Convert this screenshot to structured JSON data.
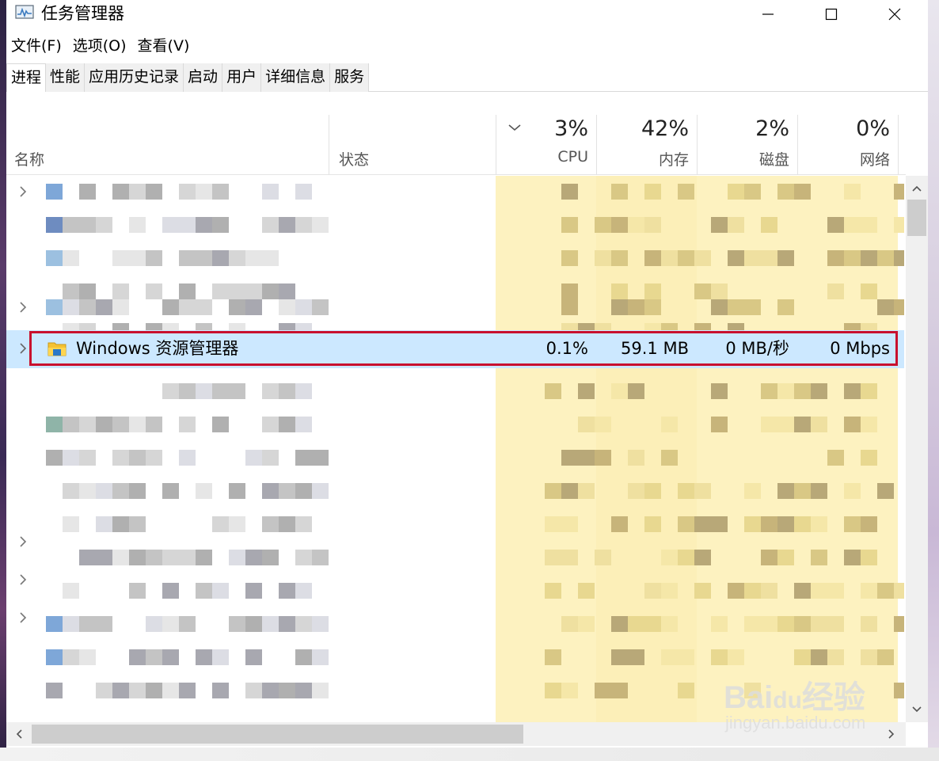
{
  "window": {
    "title": "任务管理器",
    "controls": [
      "minimize-button",
      "maximize-button",
      "close-button"
    ]
  },
  "menu": [
    "文件(F)",
    "选项(O)",
    "查看(V)"
  ],
  "tabs": [
    {
      "label": "进程",
      "active": true
    },
    {
      "label": "性能",
      "active": false
    },
    {
      "label": "应用历史记录",
      "active": false
    },
    {
      "label": "启动",
      "active": false
    },
    {
      "label": "用户",
      "active": false
    },
    {
      "label": "详细信息",
      "active": false
    },
    {
      "label": "服务",
      "active": false
    }
  ],
  "columns": {
    "name": "名称",
    "status": "状态",
    "cpu": {
      "percent": "3%",
      "label": "CPU"
    },
    "memory": {
      "percent": "42%",
      "label": "内存"
    },
    "disk": {
      "percent": "2%",
      "label": "磁盘"
    },
    "network": {
      "percent": "0%",
      "label": "网络"
    }
  },
  "highlighted_process": {
    "name": "Windows 资源管理器",
    "cpu": "0.1%",
    "memory": "59.1 MB",
    "disk": "0 MB/秒",
    "network": "0 Mbps",
    "icon": "folder-icon"
  },
  "watermark": {
    "logo": "Bai du 经验",
    "url": "jingyan.baidu.com"
  },
  "colors": {
    "selection": "#cce8ff",
    "highlight_border": "#c8102e",
    "heatmap": "#fdf2c0"
  }
}
